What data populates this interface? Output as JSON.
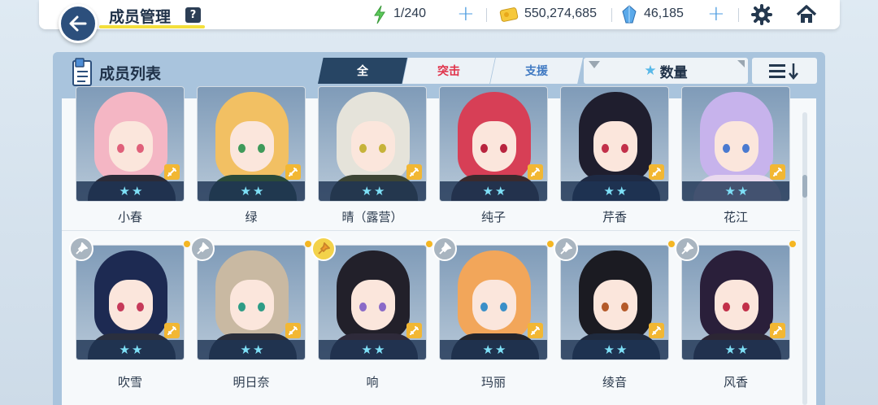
{
  "header": {
    "title": "成员管理",
    "help": "?",
    "ap": "1/240",
    "credits": "550,274,685",
    "pyroxene": "46,185"
  },
  "panel": {
    "title": "成员列表",
    "tabs": [
      {
        "label": "全"
      },
      {
        "label": "突击"
      },
      {
        "label": "支援"
      }
    ],
    "sort_label": "数量"
  },
  "colors": {
    "accent_dark": "#274564",
    "striker": "#e0324a",
    "special": "#3f79c2",
    "star": "#7ee0f7",
    "weapon_badge": "#f2b733"
  },
  "students_row1": [
    {
      "name": "小春",
      "stars": 2,
      "hair": "#f4b6c4",
      "eye": "#e0607a",
      "body": "#2b2b38"
    },
    {
      "name": "绿",
      "stars": 2,
      "hair": "#f2c063",
      "eye": "#3f9a5a",
      "body": "#2a4a3a"
    },
    {
      "name": "晴（露营）",
      "stars": 2,
      "hair": "#e5e3da",
      "eye": "#c6b33a",
      "body": "#3c4434"
    },
    {
      "name": "纯子",
      "stars": 2,
      "hair": "#d73f56",
      "eye": "#b8243e",
      "body": "#3a2a2e"
    },
    {
      "name": "芹香",
      "stars": 2,
      "hair": "#1f1e2e",
      "eye": "#c2304a",
      "body": "#1e2a44"
    },
    {
      "name": "花江",
      "stars": 2,
      "hair": "#c7b3ec",
      "eye": "#4a7ad0",
      "body": "#e9d9ee"
    }
  ],
  "students_row2": [
    {
      "name": "吹雪",
      "stars": 2,
      "hair": "#1d2a52",
      "eye": "#c63a5a",
      "body": "#2a2f3e",
      "pinned": false
    },
    {
      "name": "明日奈",
      "stars": 2,
      "hair": "#c9b9a2",
      "eye": "#2d9c86",
      "body": "#2a2e3a",
      "pinned": false
    },
    {
      "name": "响",
      "stars": 2,
      "hair": "#22202a",
      "eye": "#8a6ac8",
      "body": "#2e2a3a",
      "pinned": true
    },
    {
      "name": "玛丽",
      "stars": 2,
      "hair": "#f2a65a",
      "eye": "#3a8fc8",
      "body": "#22242c",
      "pinned": false
    },
    {
      "name": "绫音",
      "stars": 2,
      "hair": "#1b1b22",
      "eye": "#b45a2a",
      "body": "#1f2a3e",
      "pinned": false
    },
    {
      "name": "风香",
      "stars": 2,
      "hair": "#2a1f3a",
      "eye": "#c2304a",
      "body": "#2c2634",
      "pinned": false
    }
  ]
}
